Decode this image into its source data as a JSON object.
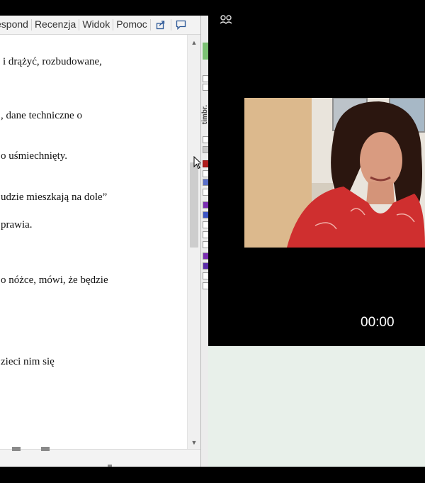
{
  "ribbon": {
    "tabs": [
      "espond",
      "Recenzja",
      "Widok",
      "Pomoc"
    ],
    "share_icon": "share-icon",
    "comment_icon": "comment-icon"
  },
  "document": {
    "lines": [
      "i drążyć, rozbudowane,",
      ", dane techniczne o",
      "o uśmiechnięty.",
      "udzie mieszkają na dole”",
      "prawia.",
      "o nóżce, mówi, że będzie",
      "zieci nim się"
    ]
  },
  "side_strip": {
    "label": "timbr."
  },
  "video": {
    "settings_icon": "settings-gear-icon",
    "timer": "00:00"
  },
  "colors": {
    "video_background": "#000000",
    "document_background": "#ffffff",
    "lower_panel": "#e8f0ea"
  }
}
